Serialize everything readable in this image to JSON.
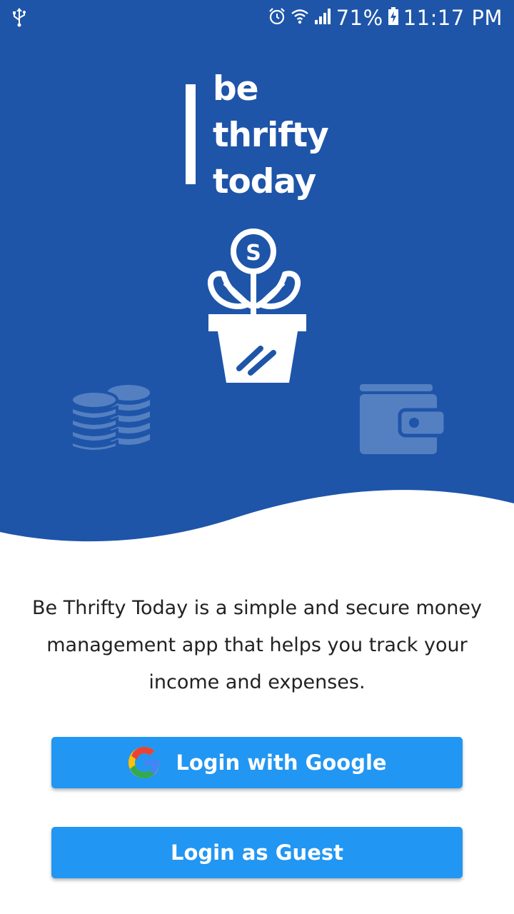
{
  "status_bar": {
    "battery": "71%",
    "time": "11:17 PM",
    "icons": [
      "usb-icon",
      "alarm-icon",
      "wifi-icon",
      "signal-icon",
      "battery-charging-icon"
    ]
  },
  "logo": {
    "line1": "be",
    "line2": "thrifty",
    "line3": "today"
  },
  "illustrations": [
    "money-plant-icon",
    "coin-stack-icon",
    "wallet-icon"
  ],
  "colors": {
    "hero_background": "#1e55a9",
    "button": "#2196f3",
    "text": "#222222"
  },
  "description": "Be Thrifty Today is a simple and secure money management app that helps you track your income and expenses.",
  "buttons": {
    "google_label": "Login with Google",
    "guest_label": "Login as Guest"
  }
}
